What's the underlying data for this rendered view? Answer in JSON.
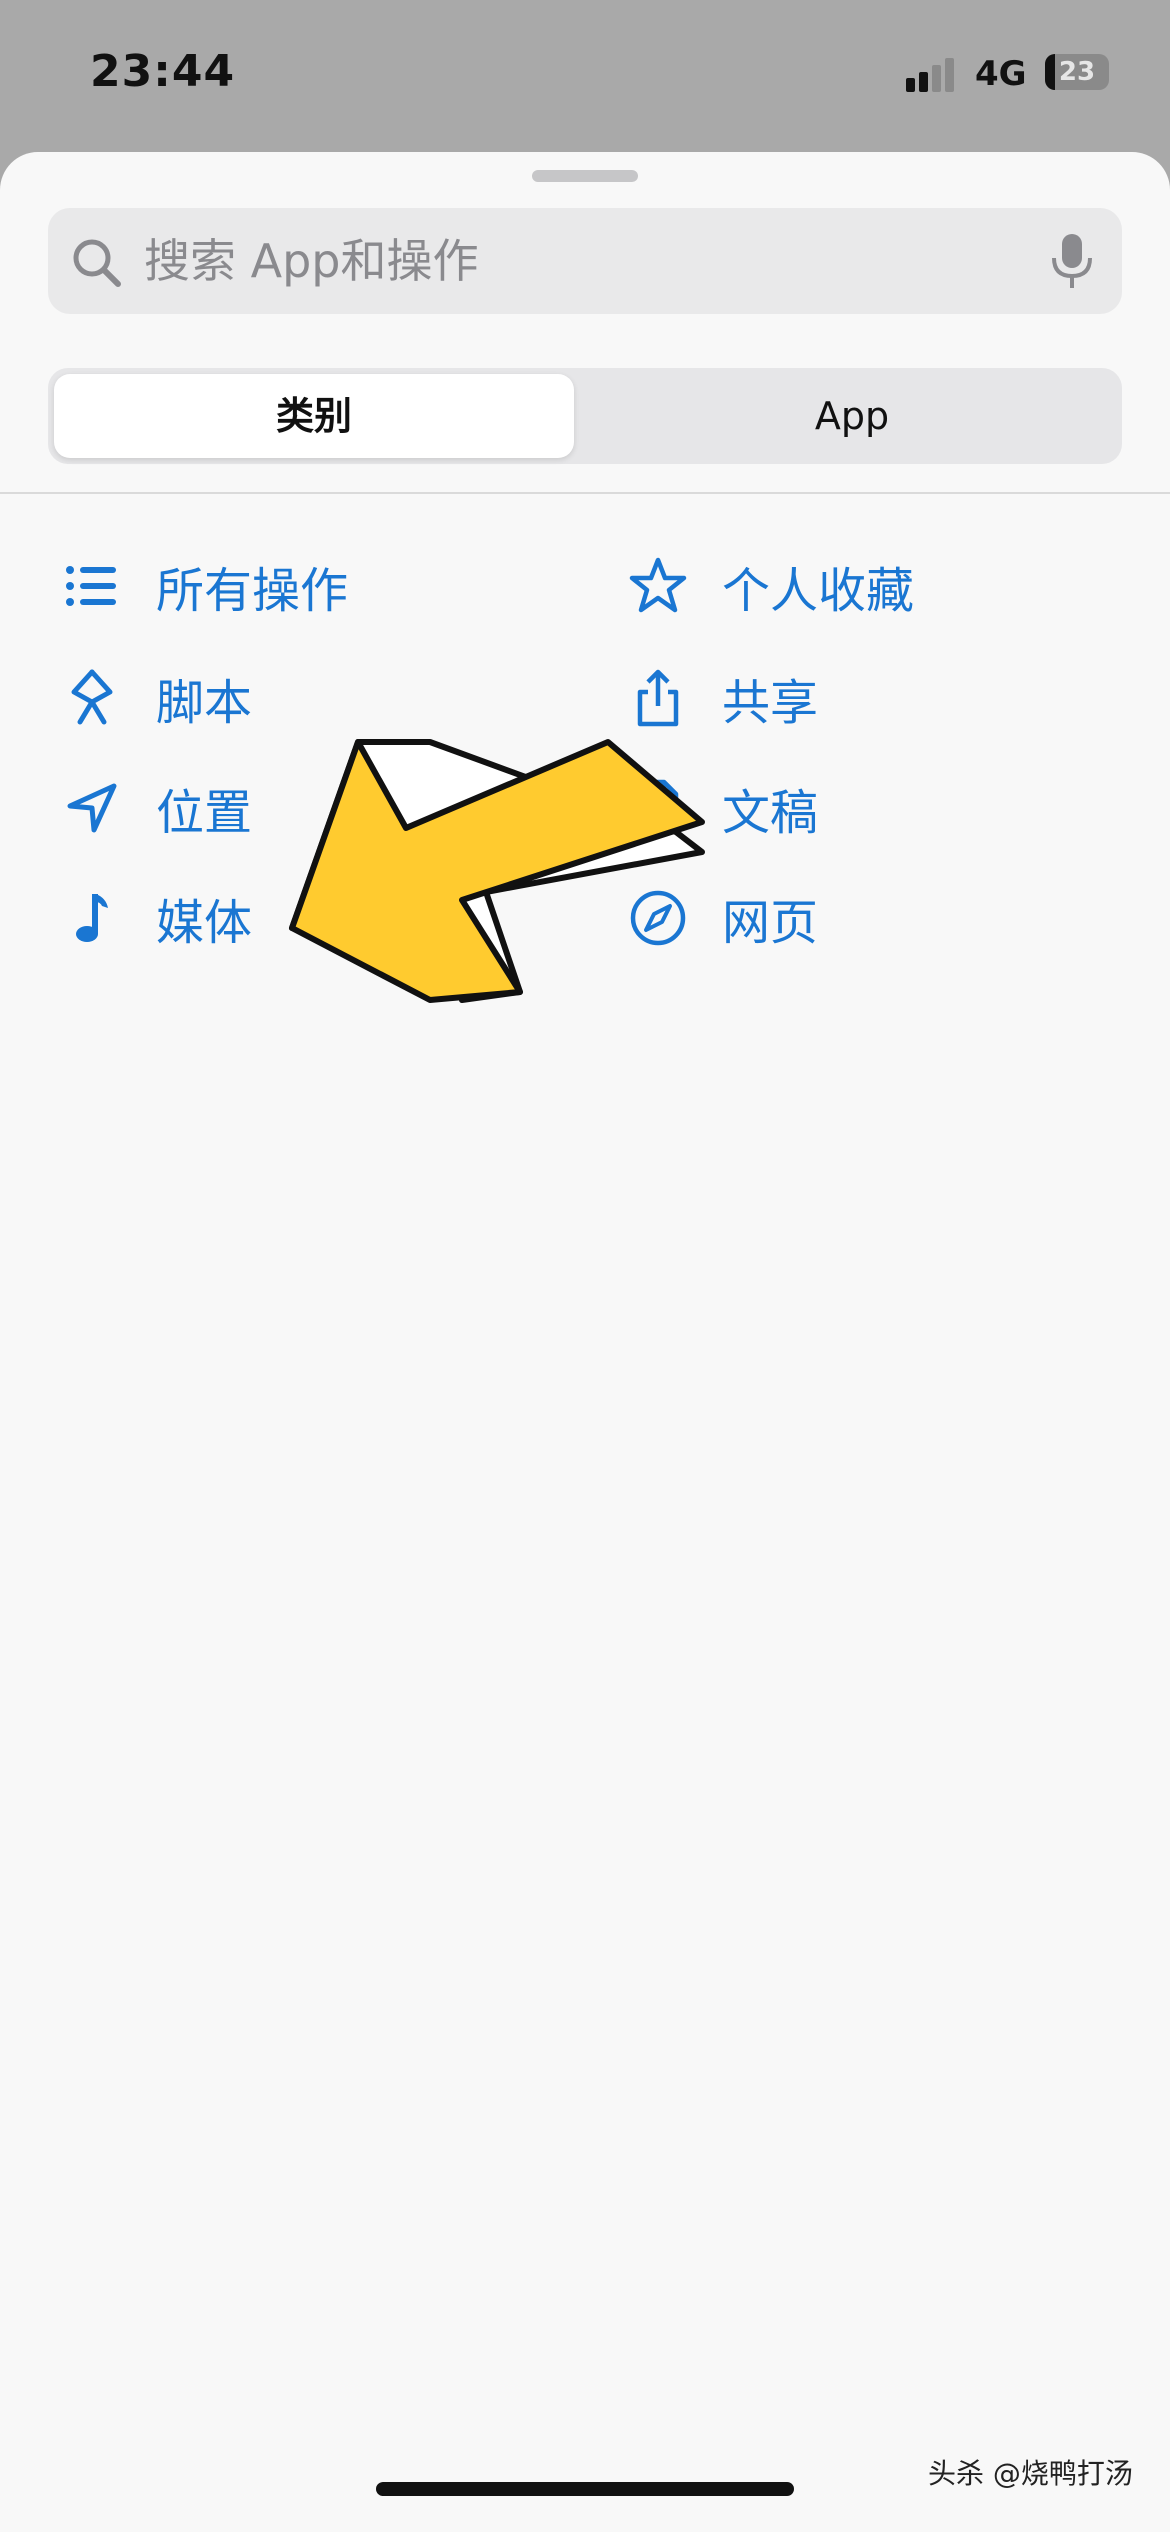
{
  "status": {
    "time": "23:44",
    "network": "4G",
    "battery": "23"
  },
  "search": {
    "placeholder": "搜索 App和操作",
    "search_icon": "search-icon",
    "mic_icon": "microphone-icon"
  },
  "segments": {
    "categories": "类别",
    "apps": "App",
    "selected": "类别"
  },
  "categories": {
    "left": [
      {
        "label": "所有操作",
        "icon": "list-icon"
      },
      {
        "label": "脚本",
        "icon": "script-icon"
      },
      {
        "label": "位置",
        "icon": "location-arrow-icon"
      },
      {
        "label": "媒体",
        "icon": "music-note-icon"
      }
    ],
    "right": [
      {
        "label": "个人收藏",
        "icon": "star-icon"
      },
      {
        "label": "共享",
        "icon": "share-icon"
      },
      {
        "label": "文稿",
        "icon": "document-icon"
      },
      {
        "label": "网页",
        "icon": "compass-icon"
      }
    ]
  },
  "overlay": {
    "arrow_color": "#ffcb2f"
  },
  "colors": {
    "accent": "#1a76d2",
    "sheet_bg": "#f8f8f8"
  },
  "watermark": "头杀 @烧鸭打汤"
}
